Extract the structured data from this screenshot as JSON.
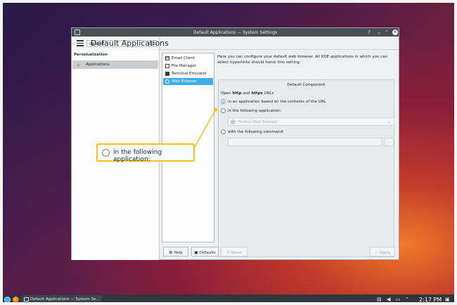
{
  "window": {
    "title": "Default Applications — System Settings"
  },
  "sidebar": {
    "search_value": "default",
    "section": "Personalization",
    "items": [
      {
        "label": "Applications"
      }
    ]
  },
  "main": {
    "title": "Default Applications",
    "components": [
      {
        "label": "Email Client"
      },
      {
        "label": "File Manager"
      },
      {
        "label": "Terminal Emulator"
      },
      {
        "label": "Web Browser"
      }
    ],
    "description": "Here you can configure your default web browser. All KDE applications in which you can select hyperlinks should honor this setting.",
    "group_title": "Default Component",
    "open_prefix": "Open ",
    "open_http": "http",
    "open_and": " and ",
    "open_https": "https",
    "open_suffix": " URLs",
    "option_url_based": "in an application based on the contents of the URL",
    "option_following_app": "in the following application:",
    "browser_selected": "Firefox Web Browser",
    "option_command": "with the following command:",
    "command_value": "",
    "browse_label": "..."
  },
  "buttons": {
    "help": "Help",
    "defaults": "Defaults",
    "reset": "Reset",
    "apply": "Apply"
  },
  "callout": {
    "text": "in the following application:"
  },
  "taskbar": {
    "task_label": "Default Applications — System Se...",
    "time": "2:17 PM"
  },
  "colors": {
    "accent": "#3daee9",
    "callout_border": "#f7c31e",
    "titlebar": "#475057",
    "taskbar": "#31363b"
  }
}
